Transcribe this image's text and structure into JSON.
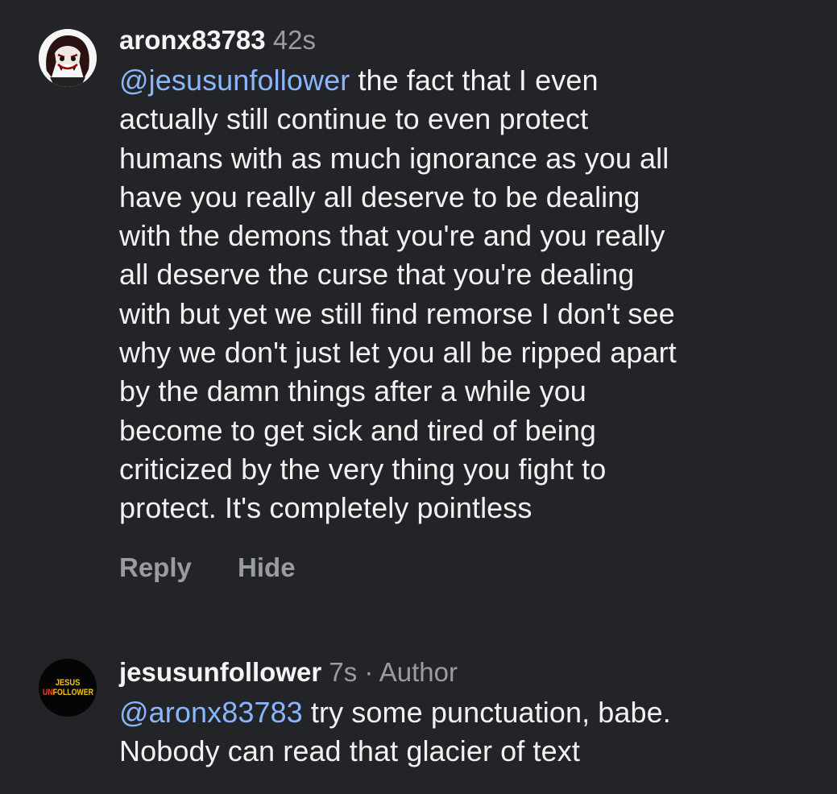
{
  "comments": [
    {
      "username": "aronx83783",
      "time": "42s",
      "author_tag": "",
      "mention": "@jesusunfollower",
      "lines": [
        " the fact that I even",
        "actually still continue to even protect",
        "humans with as much ignorance as you all",
        "have you really all deserve to be dealing",
        "with the demons that you're and you really",
        "all deserve the curse that you're dealing",
        "with but yet we still find remorse I don't see",
        "why we don't just let you all be ripped apart",
        "by the damn things after a while you",
        "become to get sick and tired of being",
        "criticized by the very thing you fight to",
        "protect. It's completely pointless"
      ],
      "actions": {
        "reply": "Reply",
        "hide": "Hide"
      }
    },
    {
      "username": "jesusunfollower",
      "time": "7s",
      "author_tag": " · Author",
      "mention": "@aronx83783",
      "lines": [
        " try some punctuation, babe.",
        "Nobody can read that glacier of text"
      ],
      "avatar_text": {
        "line1": "JESUS",
        "line2_un": "UN",
        "line2_rest": "FOLLOWER"
      }
    }
  ],
  "colors": {
    "background": "#232428",
    "mention": "#8ab6ff",
    "secondary": "#9a9ca3",
    "logo_red": "#e8452c",
    "logo_yellow": "#f2c318"
  }
}
